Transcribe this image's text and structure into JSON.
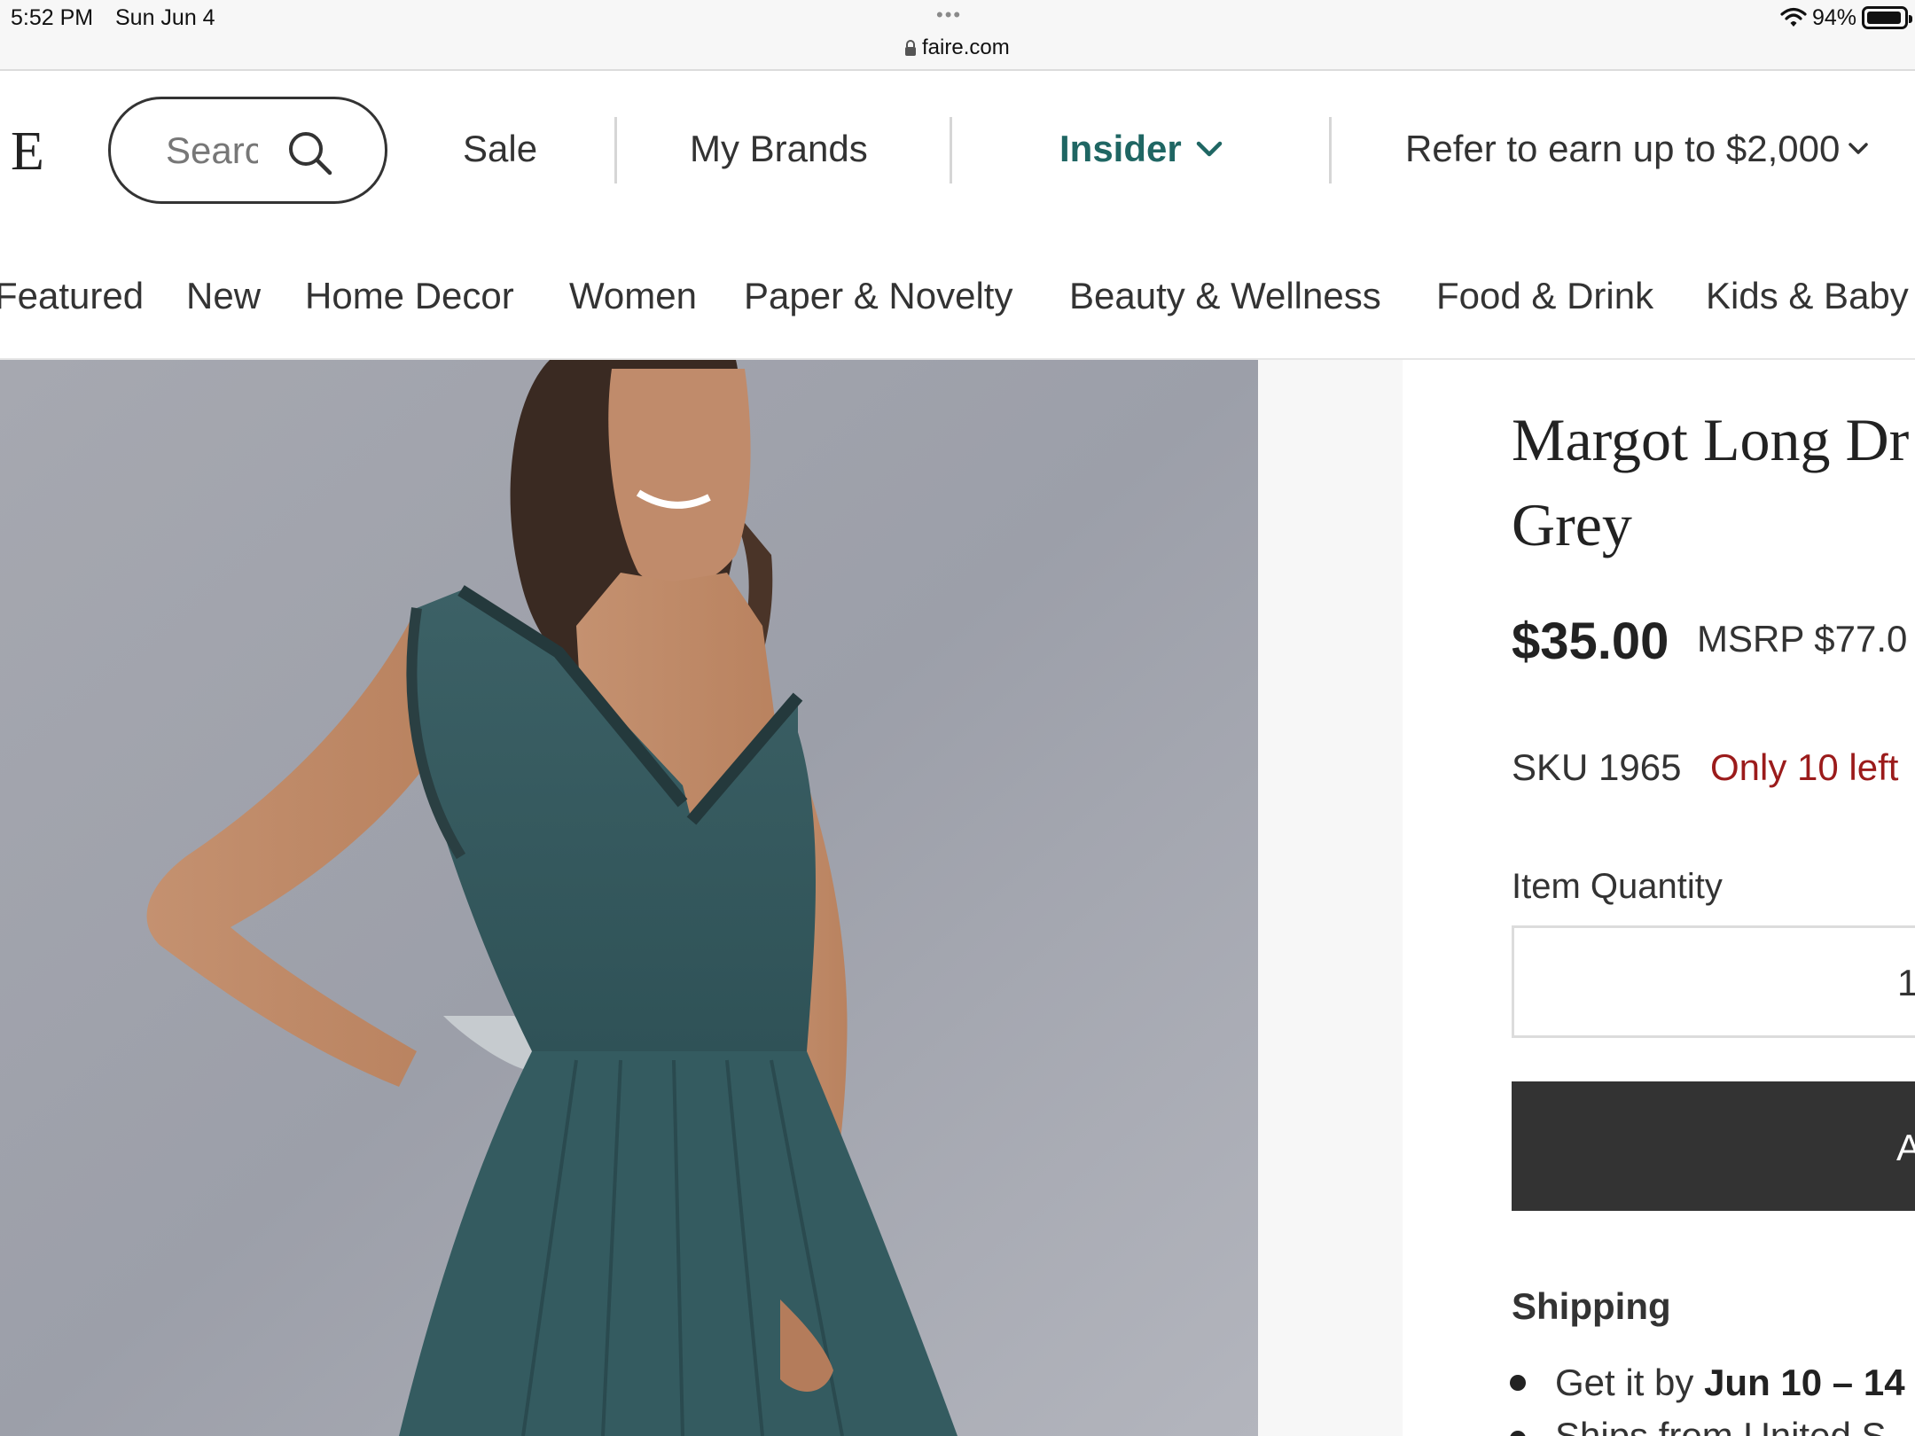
{
  "status_bar": {
    "time": "5:52 PM",
    "date": "Sun Jun 4",
    "dots": "•••",
    "battery_percent": "94%",
    "battery_level": 0.94,
    "url": "faire.com"
  },
  "header": {
    "logo_visible_text": "E",
    "search_placeholder": "Search",
    "search_visible_text": "Searc",
    "nav": {
      "sale": "Sale",
      "my_brands": "My Brands",
      "insider": "Insider",
      "refer": "Refer to earn up to $2,000"
    }
  },
  "categories": [
    "Featured",
    "New",
    "Home Decor",
    "Women",
    "Paper & Novelty",
    "Beauty & Wellness",
    "Food & Drink",
    "Kids & Baby"
  ],
  "product": {
    "title_line1": "Margot Long Dr",
    "title_line2": "Grey",
    "price": "$35.00",
    "msrp": "MSRP $77.0",
    "sku": "SKU 1965",
    "stock": "Only 10 left",
    "quantity_label": "Item Quantity",
    "quantity_value": "1",
    "add_button_label": "A",
    "shipping_heading": "Shipping",
    "shipping_line1_prefix": "Get it by",
    "shipping_line1_bold": "Jun 10 – 14",
    "shipping_line2": "Ships from United S"
  },
  "colors": {
    "accent": "#1f6663",
    "stock_warning": "#9b1b1b",
    "button_bg": "#333333"
  },
  "icons": {
    "search": "search-icon",
    "chevron": "chevron-down-icon",
    "lock": "lock-icon",
    "wifi": "wifi-icon",
    "battery": "battery-icon"
  }
}
